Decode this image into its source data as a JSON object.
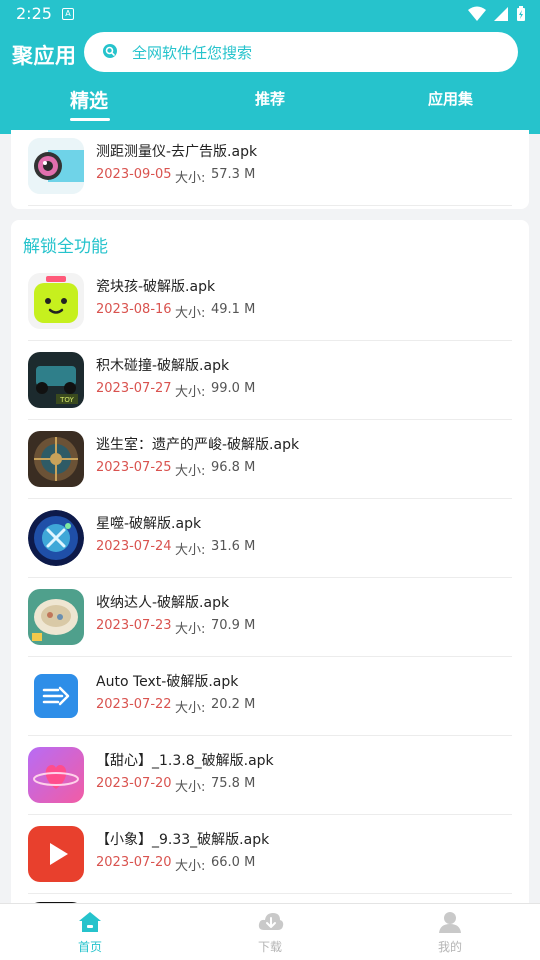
{
  "status_bar": {
    "time": "2:25",
    "notif_letter": "A"
  },
  "header": {
    "title": "聚应用",
    "search_placeholder": "全网软件任您搜索",
    "tabs": [
      {
        "label": "精选",
        "active": true
      },
      {
        "label": "推荐",
        "active": false
      },
      {
        "label": "应用集",
        "active": false
      }
    ]
  },
  "top_card": {
    "app": {
      "name": "测距测量仪-去广告版.apk",
      "date": "2023-09-05",
      "size_label": "大小:",
      "size": "57.3 M",
      "icon": "camera-ruler-icon"
    }
  },
  "section": {
    "title": "解锁全功能",
    "apps": [
      {
        "name": "瓷块孩-破解版.apk",
        "date": "2023-08-16",
        "size_label": "大小:",
        "size": "49.1 M",
        "icon": "smiley-block-icon"
      },
      {
        "name": "积木碰撞-破解版.apk",
        "date": "2023-07-27",
        "size_label": "大小:",
        "size": "99.0 M",
        "icon": "toy-car-icon"
      },
      {
        "name": "逃生室：遗产的严峻-破解版.apk",
        "date": "2023-07-25",
        "size_label": "大小:",
        "size": "96.8 M",
        "icon": "vault-door-icon"
      },
      {
        "name": "星噬-破解版.apk",
        "date": "2023-07-24",
        "size_label": "大小:",
        "size": "31.6 M",
        "icon": "galaxy-orb-icon"
      },
      {
        "name": "收纳达人-破解版.apk",
        "date": "2023-07-23",
        "size_label": "大小:",
        "size": "70.9 M",
        "icon": "storage-plate-icon"
      },
      {
        "name": "Auto Text-破解版.apk",
        "date": "2023-07-22",
        "size_label": "大小:",
        "size": "20.2 M",
        "icon": "arrow-lines-icon"
      },
      {
        "name": "【甜心】_1.3.8_破解版.apk",
        "date": "2023-07-20",
        "size_label": "大小:",
        "size": "75.8 M",
        "icon": "heart-planet-icon"
      },
      {
        "name": "【小象】_9.33_破解版.apk",
        "date": "2023-07-20",
        "size_label": "大小:",
        "size": "66.0 M",
        "icon": "play-button-icon"
      }
    ]
  },
  "bottom_nav": [
    {
      "label": "首页",
      "icon": "home-icon",
      "active": true
    },
    {
      "label": "下载",
      "icon": "cloud-download-icon",
      "active": false
    },
    {
      "label": "我的",
      "icon": "user-icon",
      "active": false
    }
  ],
  "colors": {
    "accent": "#26c3cc",
    "date": "#d9534f"
  }
}
